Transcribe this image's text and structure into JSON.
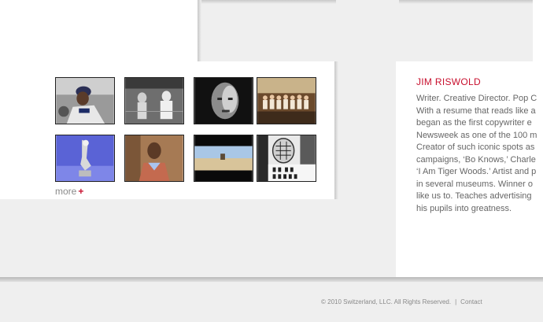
{
  "gallery": {
    "thumbnails": [
      {
        "name": "thumb-baseball-player",
        "icon": "baseball-player-image"
      },
      {
        "name": "thumb-boxing-match",
        "icon": "boxing-match-image"
      },
      {
        "name": "thumb-portrait-face",
        "icon": "portrait-face-image"
      },
      {
        "name": "thumb-team-photo",
        "icon": "team-photo-image"
      },
      {
        "name": "thumb-robot-arm",
        "icon": "robot-arm-image"
      },
      {
        "name": "thumb-boy-portrait",
        "icon": "boy-portrait-image"
      },
      {
        "name": "thumb-desert-scene",
        "icon": "desert-scene-image"
      },
      {
        "name": "thumb-hockey-protest",
        "icon": "hockey-protest-image"
      }
    ],
    "more_label": "more",
    "more_symbol": "+"
  },
  "bio": {
    "name": "JIM RISWOLD",
    "lines": [
      "Writer. Creative Director. Pop C",
      "With a resume that reads like a",
      "began as the first copywriter e",
      "Newsweek as one of the 100 m",
      "Creator of such iconic spots as",
      "campaigns, ‘Bo Knows,’ Charle",
      "‘I Am Tiger Woods.’ Artist and p",
      "in several museums. Winner o",
      "like us to. Teaches advertising",
      "his pupils into greatness."
    ]
  },
  "footer": {
    "copyright": "© 2010 Switzerland, LLC. All Rights Reserved.",
    "separator": "|",
    "contact_label": "Contact"
  },
  "colors": {
    "accent": "#c8102e",
    "panel_gray": "#efefef",
    "text_gray": "#666666"
  }
}
